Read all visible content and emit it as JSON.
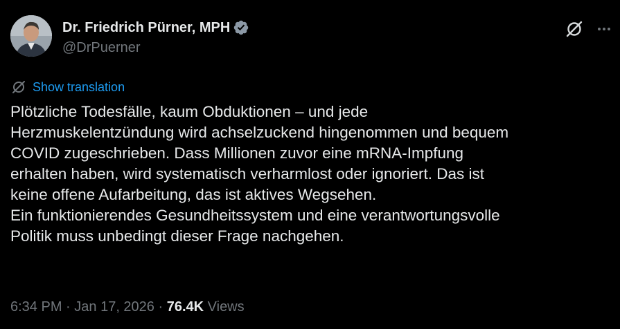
{
  "author": {
    "display_name": "Dr. Friedrich Pürner, MPH",
    "handle": "@DrPuerner",
    "avatar_icon": "person-avatar",
    "verified_icon": "verified-badge-icon",
    "verified_color": "#71767b"
  },
  "header_actions": {
    "grok_icon": "grok-icon",
    "more_icon": "more-horizontal-icon"
  },
  "translation": {
    "icon": "translate-icon",
    "label": "Show translation",
    "color": "#1d9bf0"
  },
  "tweet": {
    "lines": [
      "Plötzliche Todesfälle, kaum Obduktionen – und jede",
      "Herzmuskelentzündung wird achselzuckend hingenommen und bequem",
      "COVID zugeschrieben. Dass Millionen zuvor eine mRNA-Impfung",
      "erhalten haben, wird systematisch verharmlost oder ignoriert. Das ist",
      "keine offene Aufarbeitung, das ist aktives Wegsehen.",
      "Ein funktionierendes Gesundheitssystem und eine verantwortungsvolle",
      "Politik muss unbedingt dieser Frage nachgehen."
    ]
  },
  "meta": {
    "time": "6:34 PM",
    "separator": " · ",
    "date": "Jan 17, 2026",
    "views_count": "76.4K",
    "views_label": "Views"
  },
  "colors": {
    "background": "#000000",
    "text_primary": "#e7e9ea",
    "text_secondary": "#71767b",
    "accent": "#1d9bf0"
  }
}
